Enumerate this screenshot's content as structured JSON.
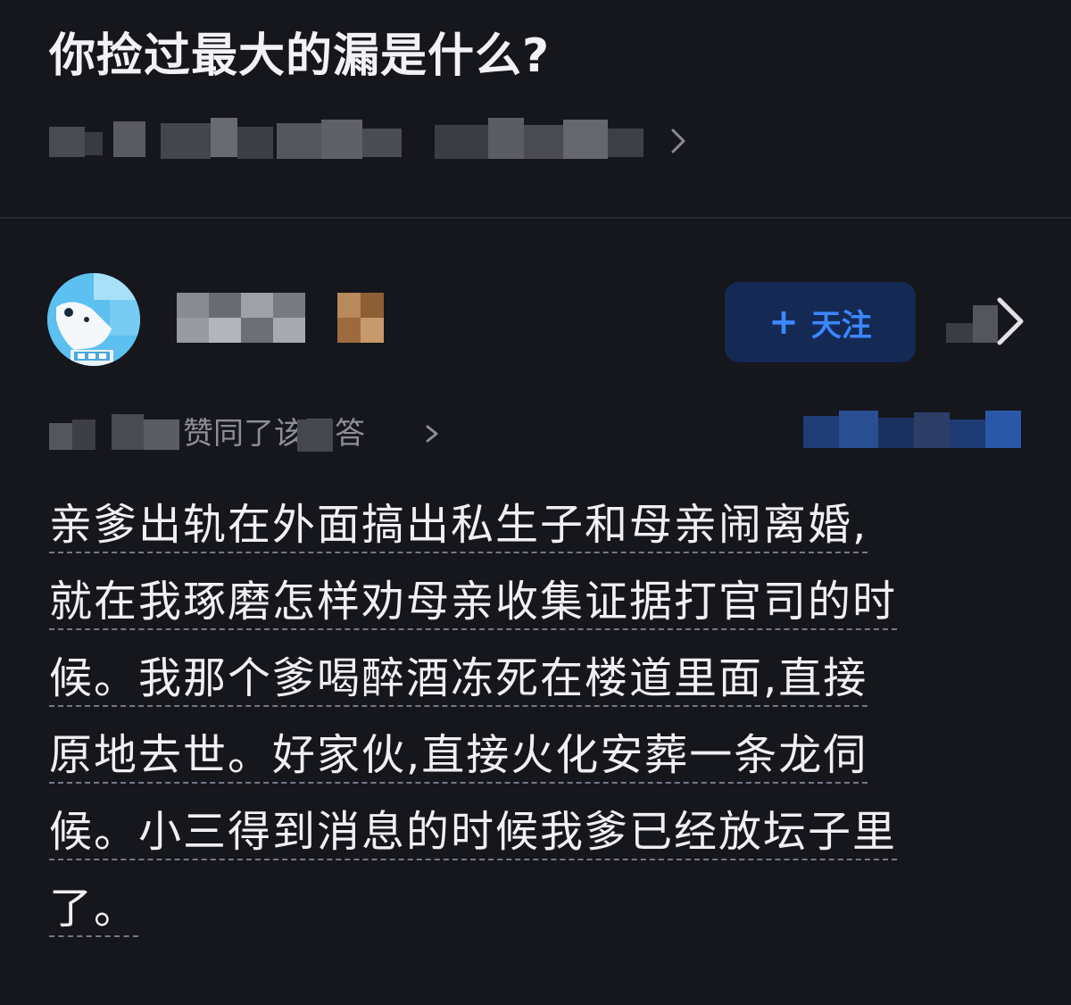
{
  "question": {
    "title": "你捡过最大的漏是什么?"
  },
  "author": {
    "avatar_icon": "polar-bear-avatar-icon",
    "follow_label": "天注",
    "follow_icon": "plus-icon",
    "share_icon": "chevron-right-icon"
  },
  "answer": {
    "votes_text": "赞同了该回答",
    "body_lines": [
      "亲爹出轨在外面搞出私生子和母亲闹离婚,",
      "就在我琢磨怎样劝母亲收集证据打官司的时",
      "候。我那个爹喝醉酒冻死在楼道里面,直接",
      "原地去世。好家伙,直接火化安葬一条龙伺",
      "候。小三得到消息的时候我爹已经放坛子里",
      "了。"
    ]
  },
  "colors": {
    "background": "#16161d",
    "accent_blue": "#3d86ff",
    "follow_bg": "#142a55",
    "muted_text": "#8d8d98"
  }
}
